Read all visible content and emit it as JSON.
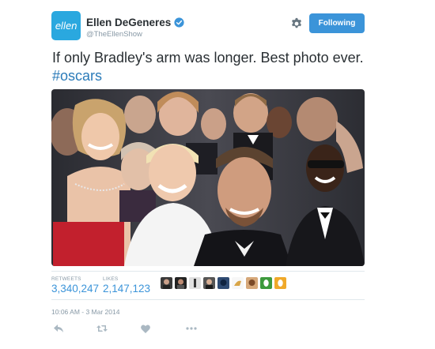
{
  "user": {
    "display_name": "Ellen DeGeneres",
    "handle": "@TheEllenShow",
    "avatar_text": "ellen",
    "verified": true
  },
  "actions_top": {
    "settings_icon": "gear-icon",
    "follow_label": "Following"
  },
  "tweet": {
    "text": "If only Bradley's arm was longer. Best photo ever. ",
    "hashtag": "#oscars"
  },
  "media": {
    "icon": "group-selfie-photo"
  },
  "stats": {
    "retweets_label": "RETWEETS",
    "retweets_value": "3,340,247",
    "likes_label": "LIKES",
    "likes_value": "2,147,123"
  },
  "timestamp": "10:06 AM - 3 Mar 2014",
  "footer_actions": [
    "reply-icon",
    "retweet-icon",
    "like-icon",
    "more-icon"
  ],
  "colors": {
    "accent": "#3b94d9",
    "hashtag": "#2b7bb9",
    "muted": "#8899a6"
  }
}
